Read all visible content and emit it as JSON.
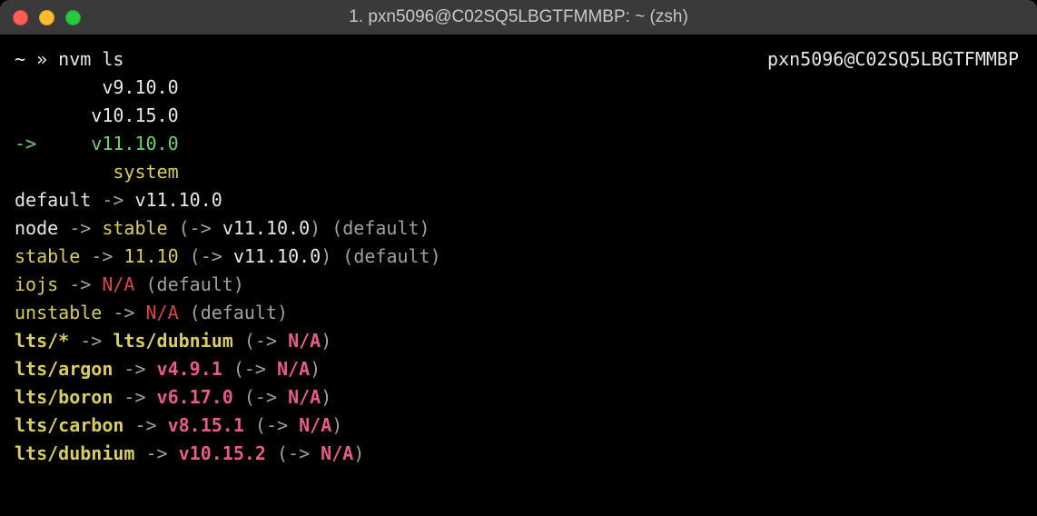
{
  "titlebar": {
    "title": "1. pxn5096@C02SQ5LBGTFMMBP: ~ (zsh)"
  },
  "host_indicator": "pxn5096@C02SQ5LBGTFMMBP",
  "prompt": {
    "symbol": "~ » ",
    "command": "nvm ls"
  },
  "installed": [
    {
      "prefix": "        ",
      "version": "v9.10.0",
      "current": false
    },
    {
      "prefix": "       ",
      "version": "v10.15.0",
      "current": false
    },
    {
      "prefix": "->     ",
      "version": "v11.10.0",
      "current": true
    },
    {
      "prefix": "         ",
      "version": "system",
      "system": true
    }
  ],
  "aliases": {
    "default": {
      "name": "default",
      "arrow": " -> ",
      "target": "v11.10.0"
    },
    "node": {
      "name": "node",
      "arrow": " -> ",
      "target": "stable",
      "resolved_arrow": " (-> ",
      "resolved": "v11.10.0",
      "close": ")",
      "suffix": " (default)"
    },
    "stable": {
      "name": "stable",
      "arrow": " -> ",
      "target": "11.10",
      "resolved_arrow": " (-> ",
      "resolved": "v11.10.0",
      "close": ")",
      "suffix": " (default)"
    },
    "iojs": {
      "name": "iojs",
      "arrow": " -> ",
      "target": "N/A",
      "suffix": " (default)"
    },
    "unstable": {
      "name": "unstable",
      "arrow": " -> ",
      "target": "N/A",
      "suffix": " (default)"
    }
  },
  "lts": [
    {
      "name": "lts/*",
      "arrow": " -> ",
      "target": "lts/dubnium",
      "resolved_arrow": " (-> ",
      "resolved": "N/A",
      "close": ")"
    },
    {
      "name": "lts/argon",
      "arrow": " -> ",
      "target": "v4.9.1",
      "resolved_arrow": " (-> ",
      "resolved": "N/A",
      "close": ")"
    },
    {
      "name": "lts/boron",
      "arrow": " -> ",
      "target": "v6.17.0",
      "resolved_arrow": " (-> ",
      "resolved": "N/A",
      "close": ")"
    },
    {
      "name": "lts/carbon",
      "arrow": " -> ",
      "target": "v8.15.1",
      "resolved_arrow": " (-> ",
      "resolved": "N/A",
      "close": ")"
    },
    {
      "name": "lts/dubnium",
      "arrow": " -> ",
      "target": "v10.15.2",
      "resolved_arrow": " (-> ",
      "resolved": "N/A",
      "close": ")"
    }
  ]
}
